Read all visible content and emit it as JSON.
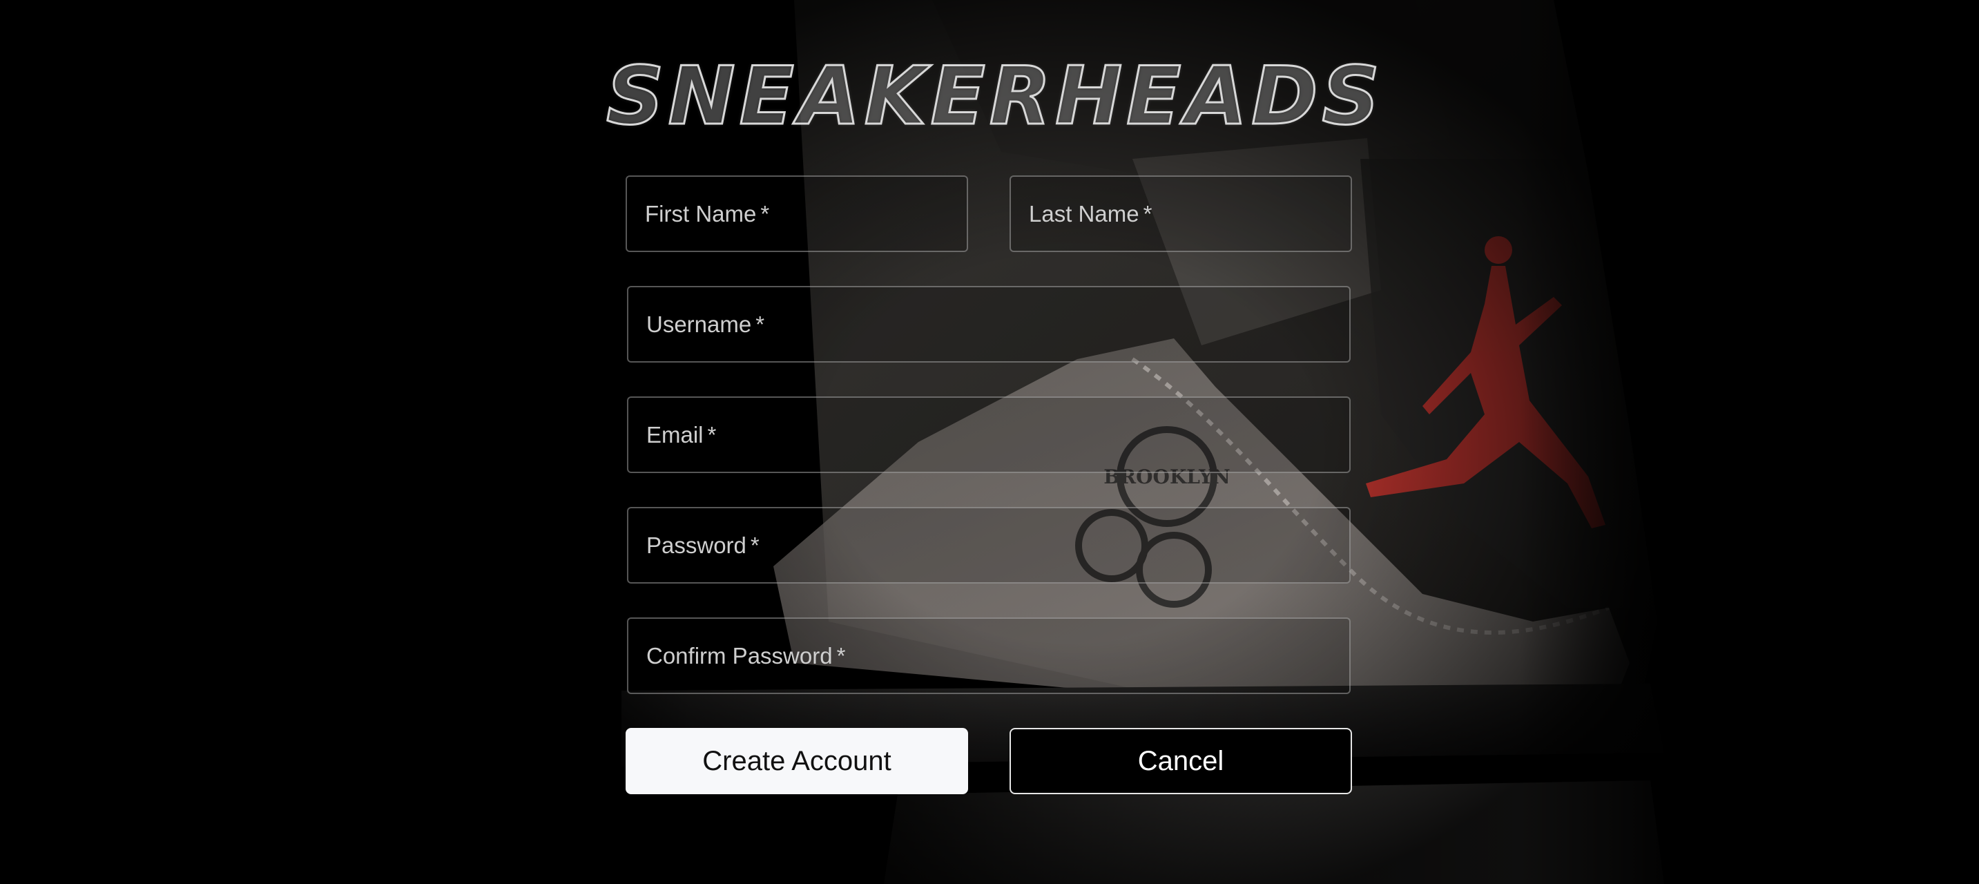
{
  "brand": {
    "title": "SNEAKERHEADS"
  },
  "form": {
    "first_name": {
      "label": "First Name",
      "required_mark": "*"
    },
    "last_name": {
      "label": "Last Name",
      "required_mark": "*"
    },
    "username": {
      "label": "Username",
      "required_mark": "*"
    },
    "email": {
      "label": "Email",
      "required_mark": "*"
    },
    "password": {
      "label": "Password",
      "required_mark": "*"
    },
    "confirm_password": {
      "label": "Confirm Password",
      "required_mark": "*"
    }
  },
  "actions": {
    "create_label": "Create Account",
    "cancel_label": "Cancel"
  },
  "background": {
    "logo_text": "BROOKLYN",
    "accent_color": "#b8322c"
  }
}
